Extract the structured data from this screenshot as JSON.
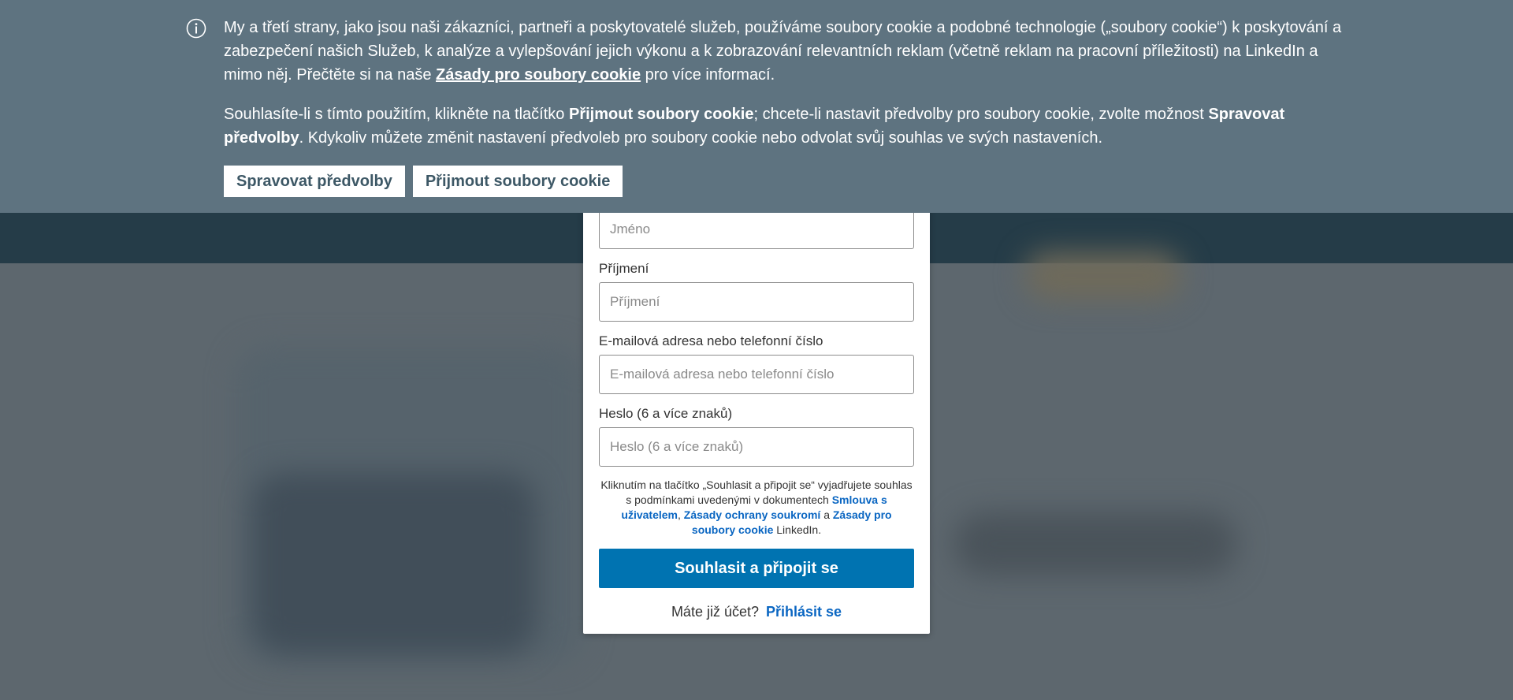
{
  "cookie_banner": {
    "paragraph1_before_link": "My a třetí strany, jako jsou naši zákazníci, partneři a poskytovatelé služeb, používáme soubory cookie a podobné technologie („soubory cookie“) k poskytování a zabezpečení našich Služeb, k analýze a vylepšování jejich výkonu a k zobrazování relevantních reklam (včetně reklam na pracovní příležitosti) na LinkedIn a mimo něj. Přečtěte si na naše",
    "policy_link": "Zásady pro soubory cookie",
    "paragraph1_after_link": "pro více informací.",
    "paragraph2_part1": "Souhlasíte-li s tímto použitím, klikněte na tlačítko",
    "paragraph2_bold1": "Přijmout soubory cookie",
    "paragraph2_part2": "; chcete-li nastavit předvolby pro soubory cookie, zvolte možnost",
    "paragraph2_bold2": "Spravovat předvolby",
    "paragraph2_part3": ". Kdykoliv můžete změnit nastavení předvoleb pro soubory cookie nebo odvolat svůj souhlas ve svých nastaveních.",
    "manage_button": "Spravovat předvolby",
    "accept_button": "Přijmout soubory cookie",
    "info_icon": "info-circle-icon"
  },
  "signup_form": {
    "first_name_placeholder": "Jméno",
    "last_name_label": "Příjmení",
    "last_name_placeholder": "Příjmení",
    "email_label": "E-mailová adresa nebo telefonní číslo",
    "email_placeholder": "E-mailová adresa nebo telefonní číslo",
    "password_label": "Heslo (6 a více znaků)",
    "password_placeholder": "Heslo (6 a více znaků)",
    "terms_part1": "Kliknutím na tlačítko „Souhlasit a připojit se“ vyjadřujete souhlas s podmínkami uvedenými v dokumentech",
    "terms_link1": "Smlouva s uživatelem",
    "terms_sep": ",",
    "terms_link2": "Zásady ochrany soukromí",
    "terms_and": "a",
    "terms_link3": "Zásady pro soubory cookie",
    "terms_end": "LinkedIn.",
    "join_button": "Souhlasit a připojit se",
    "have_account": "Máte již účet?",
    "signin_link": "Přihlásit se"
  },
  "colors": {
    "banner_bg": "#5e7380",
    "primary_blue": "#0073b1",
    "link_blue": "#0a66c2",
    "header_bg": "#253c48"
  }
}
